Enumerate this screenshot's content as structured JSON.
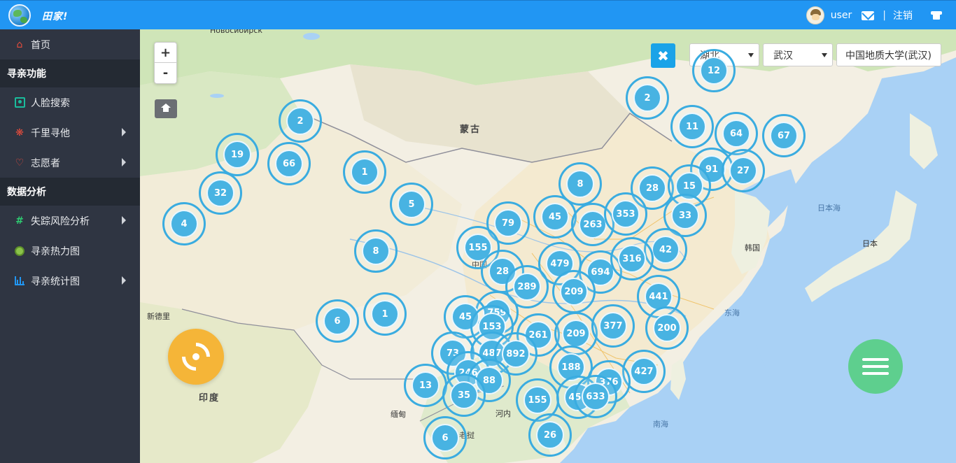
{
  "header": {
    "app_title": "田家!",
    "username": "user",
    "separator": "|",
    "logout_label": "注销",
    "bg_color": "#2196f3"
  },
  "sidebar": {
    "home": "首页",
    "section1": "寻亲功能",
    "items1": [
      "人脸搜索",
      "千里寻他",
      "志愿者"
    ],
    "section2": "数据分析",
    "items2": [
      "失踪风险分析",
      "寻亲热力图",
      "寻亲统计图"
    ]
  },
  "map": {
    "zoom_in": "+",
    "zoom_out": "-",
    "province": "湖北",
    "city": "武汉",
    "location": "中国地质大学(武汉)",
    "labels": {
      "mongolia": "蒙古",
      "china": "中国",
      "india": "印度",
      "japan": "日本",
      "korea": "韩国",
      "novosibirsk": "Новосибирск",
      "myanmar": "缅甸",
      "laos": "老挝",
      "hanoi": "河内",
      "delhi": "新德里",
      "sea_japan": "日本海",
      "east_sea": "东海",
      "south_sea": "南海"
    },
    "clusters": [
      "12",
      "2",
      "11",
      "64",
      "67",
      "91",
      "27",
      "2",
      "19",
      "66",
      "1",
      "32",
      "5",
      "8",
      "28",
      "15",
      "4",
      "79",
      "45",
      "263",
      "353",
      "33",
      "8",
      "155",
      "42",
      "28",
      "479",
      "694",
      "316",
      "289",
      "209",
      "1",
      "6",
      "759",
      "441",
      "45",
      "153",
      "261",
      "209",
      "377",
      "200",
      "73",
      "487",
      "892",
      "246",
      "188",
      "13",
      "88",
      "427",
      "376",
      "35",
      "155",
      "455",
      "633",
      "6",
      "26"
    ]
  }
}
